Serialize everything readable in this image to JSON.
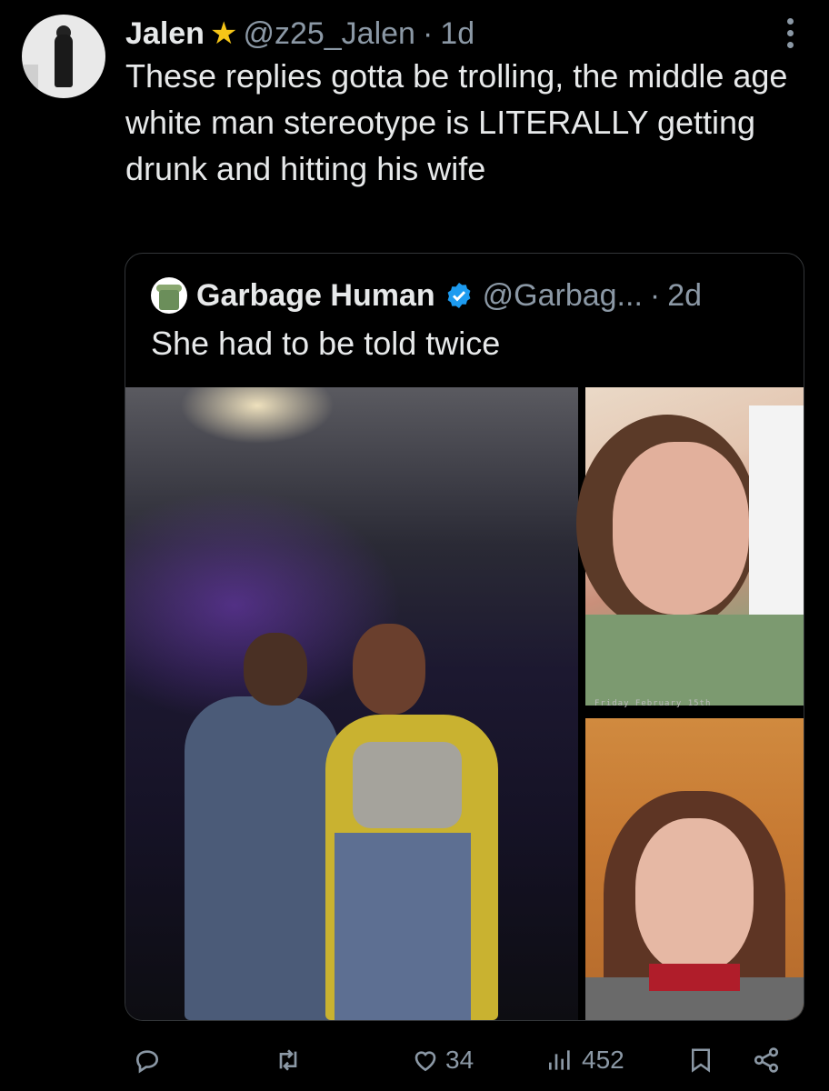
{
  "tweet": {
    "author_name": "Jalen",
    "handle": "@z25_Jalen",
    "separator": "·",
    "time": "1d",
    "text": "These replies gotta be trolling, the middle age white man stereotype is LITERALLY getting drunk and hitting his wife"
  },
  "quoted_tweet": {
    "author_name": "Garbage Human",
    "handle": "@Garbag...",
    "separator": "·",
    "time": "2d",
    "text": "She had to be told twice",
    "photo_caption_stamp": "Friday  February 15th"
  },
  "actions": {
    "reply_count": "",
    "retweet_count": "",
    "like_count": "34",
    "views_count": "452"
  },
  "colors": {
    "background": "#000000",
    "text": "#e7e9ea",
    "muted": "#8b98a5",
    "verified": "#1d9bf0",
    "star": "#f5c518"
  }
}
